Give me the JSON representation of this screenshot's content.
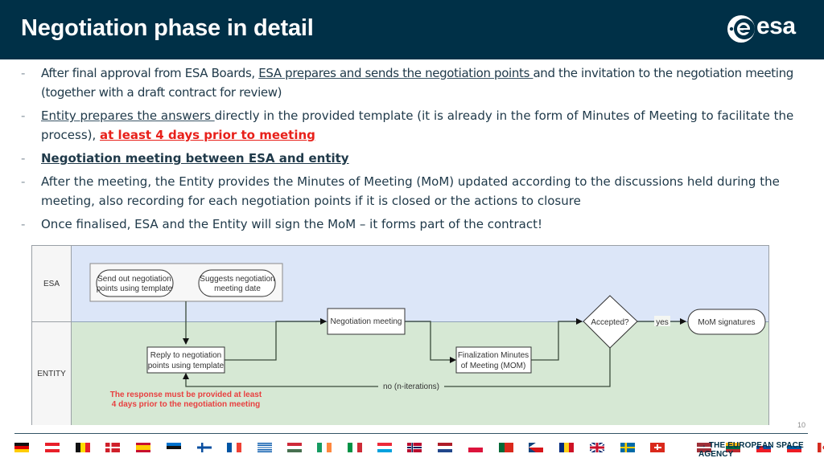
{
  "header": {
    "title": "Negotiation phase in detail",
    "logo_text": "esa",
    "logo_icon": "esa-logo-icon"
  },
  "colors": {
    "header_bg": "#003047",
    "text": "#203a4a",
    "emphasis_red": "#e8201a",
    "lane_esa": "#dce6f8",
    "lane_entity": "#d6e8d4",
    "note_red": "#e84040"
  },
  "bullets": [
    {
      "parts": [
        {
          "text": "After final approval from ESA Boards, ",
          "style": "plain"
        },
        {
          "text": "ESA prepares and sends the negotiation points ",
          "style": "underline"
        },
        {
          "text": "and the invitation to the negotiation meeting (together with a draft contract for review)",
          "style": "plain"
        }
      ]
    },
    {
      "parts": [
        {
          "text": "Entity prepares the answers ",
          "style": "underline"
        },
        {
          "text": "directly in the provided template (it is already in the form of Minutes of Meeting to facilitate the process), ",
          "style": "plain"
        },
        {
          "text": "at least 4 days prior to meeting",
          "style": "red-bold-underline"
        }
      ]
    },
    {
      "parts": [
        {
          "text": "Negotiation meeting between ESA and entity",
          "style": "bold-underline"
        }
      ]
    },
    {
      "parts": [
        {
          "text": "After the meeting, the Entity provides the Minutes of Meeting (MoM) updated according to the discussions held during the meeting, also recording for each negotiation points if it is closed or the actions to closure",
          "style": "plain"
        }
      ]
    },
    {
      "parts": [
        {
          "text": "Once finalised, ESA and the Entity will sign the MoM – it forms part of the contract!",
          "style": "plain"
        }
      ]
    }
  ],
  "diagram": {
    "lanes": [
      {
        "label": "ESA"
      },
      {
        "label": "ENTITY"
      }
    ],
    "nodes": {
      "send_points": {
        "lines": [
          "Send out negotiation",
          "points using template"
        ],
        "shape": "rounded"
      },
      "suggest_date": {
        "lines": [
          "Suggests negotiation",
          "meeting date"
        ],
        "shape": "rounded"
      },
      "reply": {
        "lines": [
          "Reply to negotiation",
          "points using template"
        ],
        "shape": "rect"
      },
      "negotiation_meeting": {
        "lines": [
          "Negotiation meeting"
        ],
        "shape": "rect"
      },
      "finalization": {
        "lines": [
          "Finalization Minutes",
          "of Meeting (MOM)"
        ],
        "shape": "rect"
      },
      "accepted": {
        "lines": [
          "Accepted?"
        ],
        "shape": "diamond"
      },
      "signatures": {
        "lines": [
          "MoM signatures"
        ],
        "shape": "rounded"
      }
    },
    "edge_labels": {
      "yes": "yes",
      "no": "no (n-iterations)"
    },
    "note": [
      "The response must be provided at least",
      "4 days prior to the negotiation meeting"
    ]
  },
  "footer": {
    "page_number": "10",
    "agency": "→ THE EUROPEAN SPACE AGENCY",
    "flags": [
      "Germany",
      "Austria",
      "Belgium",
      "Denmark",
      "Spain",
      "Estonia",
      "Finland",
      "France",
      "Greece",
      "Hungary",
      "Ireland",
      "Italy",
      "Luxembourg",
      "Norway",
      "Netherlands",
      "Poland",
      "Portugal",
      "Czech Republic",
      "Romania",
      "United Kingdom",
      "Sweden",
      "Switzerland",
      "Latvia",
      "Lithuania",
      "Slovakia",
      "Slovenia",
      "Canada"
    ]
  }
}
